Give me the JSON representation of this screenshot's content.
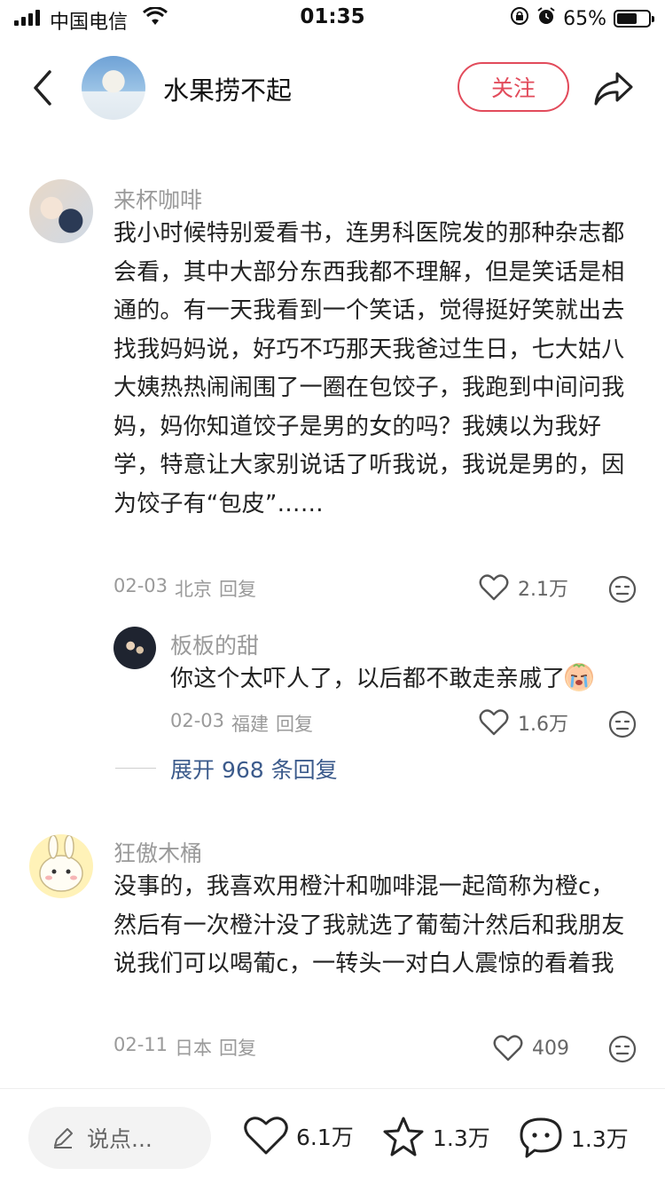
{
  "status_bar": {
    "carrier": "中国电信",
    "time": "01:35",
    "battery_percent": "65%",
    "battery_level": 0.65
  },
  "header": {
    "author_name": "水果捞不起",
    "follow_label": "关注"
  },
  "comments": [
    {
      "user": "来杯咖啡",
      "text": "我小时候特别爱看书，连男科医院发的那种杂志都会看，其中大部分东西我都不理解，但是笑话是相通的。有一天我看到一个笑话，觉得挺好笑就出去找我妈妈说，好巧不巧那天我爸过生日，七大姑八大姨热热闹闹围了一圈在包饺子，我跑到中间问我妈，妈你知道饺子是男的女的吗？我姨以为我好学，特意让大家别说话了听我说，我说是男的，因为饺子有“包皮”……",
      "date": "02-03",
      "location": "北京",
      "reply_label": "回复",
      "likes": "2.1万"
    },
    {
      "user": "狂傲木桶",
      "text": "没事的，我喜欢用橙汁和咖啡混一起简称为橙c，然后有一次橙汁没了我就选了葡萄汁然后和我朋友说我们可以喝葡c，一转头一对白人震惊的看着我",
      "date": "02-11",
      "location": "日本",
      "reply_label": "回复",
      "likes": "409"
    }
  ],
  "sub_reply": {
    "user": "板板的甜",
    "text": "你这个太吓人了，以后都不敢走亲戚了",
    "date": "02-03",
    "location": "福建",
    "reply_label": "回复",
    "likes": "1.6万"
  },
  "expand_replies": "展开 968 条回复",
  "bottom_bar": {
    "input_placeholder": "说点...",
    "like_count": "6.1万",
    "favorite_count": "1.3万",
    "comment_count": "1.3万"
  },
  "colors": {
    "accent": "#e24b5b",
    "link": "#3c5b8c",
    "meta_gray": "#9a9a9a"
  },
  "icons": [
    "signal-icon",
    "wifi-icon",
    "lock-rotation-icon",
    "alarm-icon",
    "battery-icon",
    "back-icon",
    "share-icon",
    "heart-icon",
    "dislike-face-icon",
    "crying-emoji-icon",
    "pencil-icon",
    "star-icon",
    "chat-bubble-icon"
  ]
}
